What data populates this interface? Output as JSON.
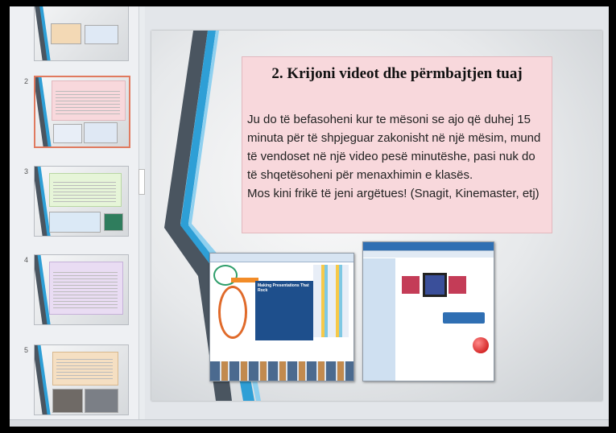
{
  "thumbnails": [
    {
      "number": "",
      "label": "",
      "selected": false
    },
    {
      "number": "2",
      "label": "",
      "selected": true
    },
    {
      "number": "3",
      "label": "",
      "selected": false
    },
    {
      "number": "4",
      "label": "",
      "selected": false
    },
    {
      "number": "5",
      "label": "",
      "selected": false
    }
  ],
  "slide": {
    "title": "2. Krijoni videot dhe përmbajtjen tuaj",
    "body_lines": [
      "Ju do të befasoheni kur te mësoni se ajo që duhej 15",
      "minuta për të shpjeguar zakonisht në një mësim, mund",
      "të vendoset në një video pesë minutëshe, pasi nuk do",
      "të shqetësoheni për menaxhimin e klasës.",
      "Mos kini frikë të jeni argëtues! (Snagit, Kinemaster, etj)"
    ],
    "screenshot_left_panel": "Making Presentations That Rock",
    "colors": {
      "content_box": "#f8d8dc",
      "ribbon_dark": "#4a5560",
      "ribbon_blue": "#2e9fd6",
      "thumb_selected_border": "#e07a5f"
    }
  }
}
